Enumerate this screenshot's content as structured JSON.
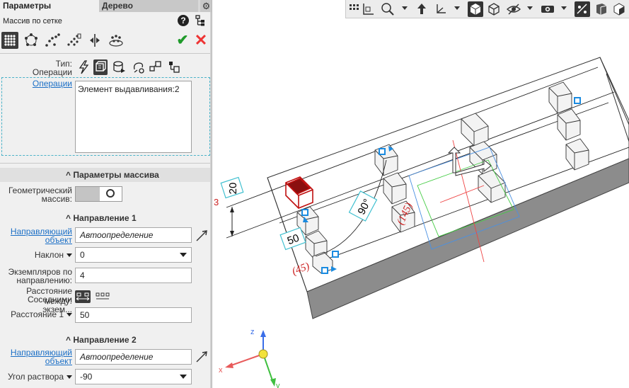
{
  "tabs": {
    "params": "Параметры",
    "tree": "Дерево"
  },
  "operation": {
    "title": "Массив по сетке"
  },
  "type_section": {
    "type_label": "Тип:",
    "type_value": "Операции",
    "operations_link": "Операции",
    "operations_list": [
      "Элемент выдавливания:2"
    ]
  },
  "array_params": {
    "header": "Параметры массива",
    "geometric_label_1": "Геометрический",
    "geometric_label_2": "массив:",
    "toggle_state": "off"
  },
  "direction1": {
    "header": "Направление 1",
    "guide_label_1": "Направляющий",
    "guide_label_2": "объект",
    "guide_value": "Автоопределение",
    "tilt_label": "Наклон",
    "tilt_value": "0",
    "count_label_1": "Экземпляров по",
    "count_label_2": "направлению:",
    "count_value": "4",
    "distance_between_1": "Расстояние между:",
    "distance_between_2": "Соседними экзем...",
    "distance_label": "Расстояние 1",
    "distance_value": "50"
  },
  "direction2": {
    "header": "Направление 2",
    "guide_label_1": "Направляющий",
    "guide_label_2": "объект",
    "guide_value": "Автоопределение",
    "angle_label": "Угол раствора",
    "angle_value": "-90"
  },
  "scene": {
    "dim_20": "20",
    "dim_50": "50",
    "dim_90": "90°",
    "red_45": "(45)",
    "red_145": "(145)",
    "axis_x": "x",
    "axis_y": "y",
    "axis_z": "z"
  },
  "colors": {
    "accent_ok": "#1f9a2a",
    "accent_cancel": "#ee3333",
    "link": "#1b6fc6",
    "handle_blue": "#1a8be0",
    "dim_cyan": "#40c0d0",
    "selection_red": "#c01010"
  }
}
